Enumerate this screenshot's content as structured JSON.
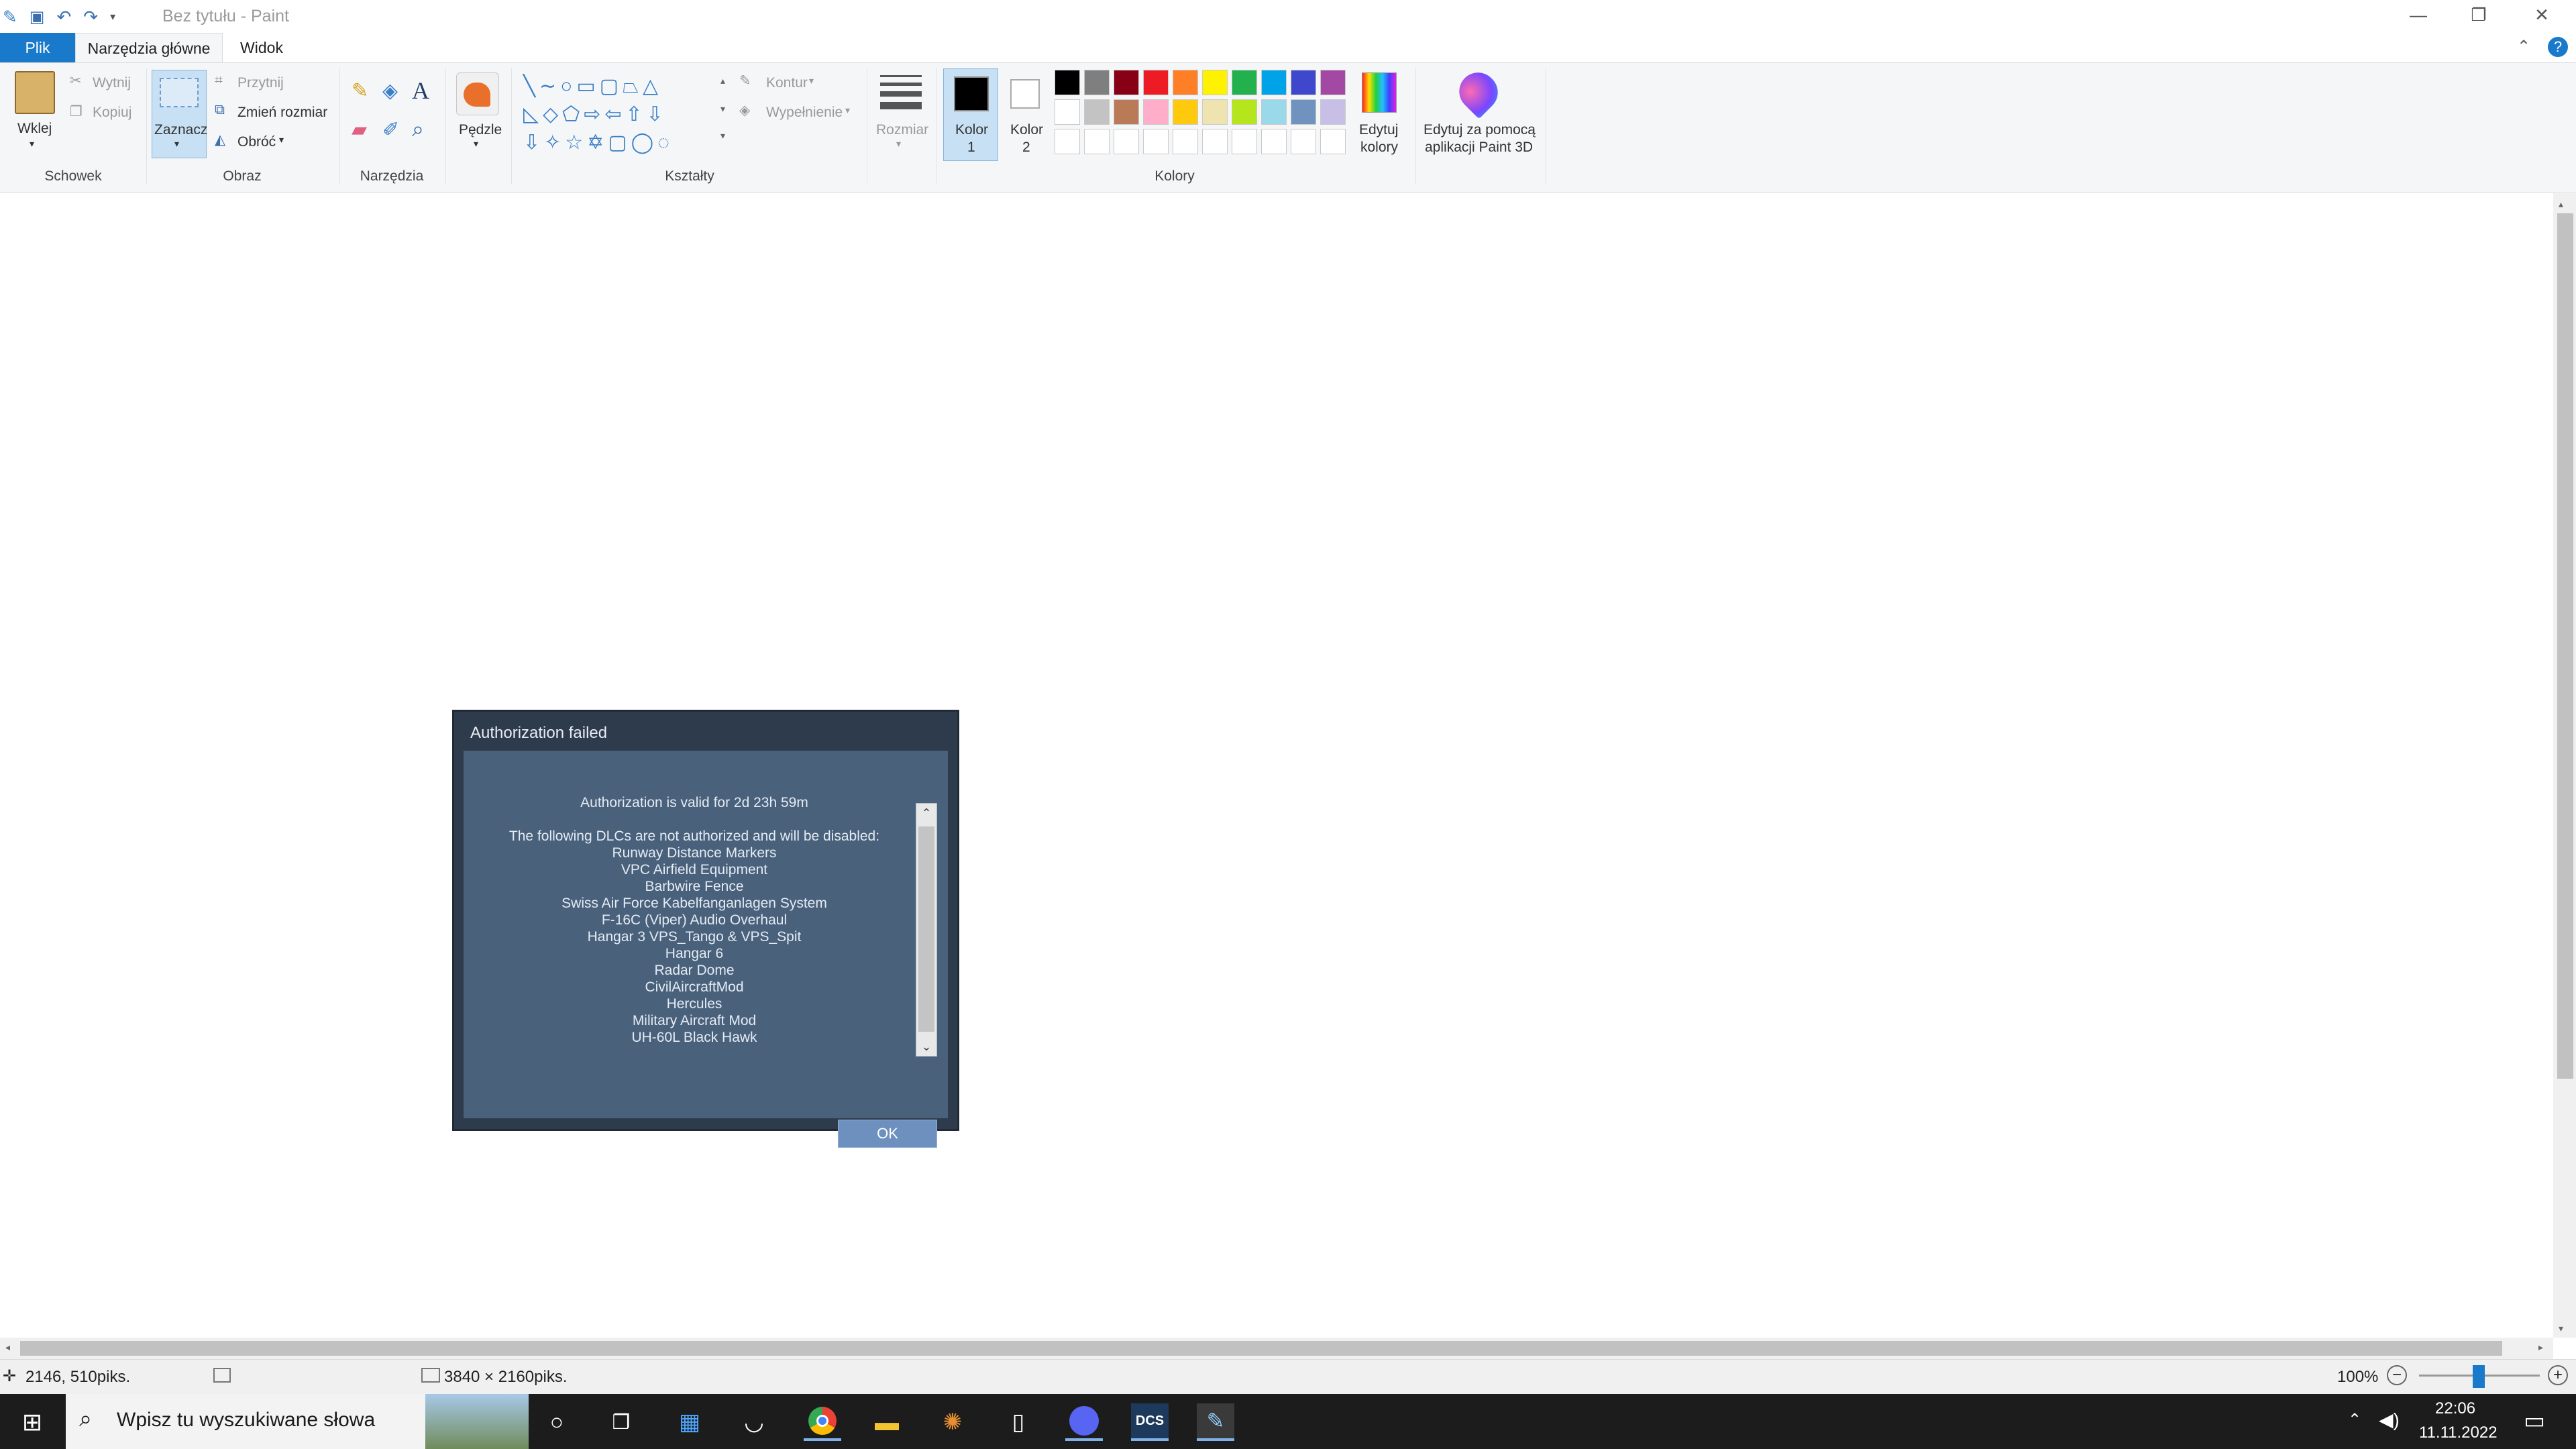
{
  "window": {
    "title": "Bez tytułu - Paint",
    "controls": {
      "minimize": "—",
      "restore": "❐",
      "close": "✕"
    }
  },
  "ribbon_tabs": [
    {
      "label": "Plik",
      "active": false
    },
    {
      "label": "Narzędzia główne",
      "active": true
    },
    {
      "label": "Widok",
      "active": false
    }
  ],
  "ribbon": {
    "clipboard": {
      "paste": "Wklej",
      "cut": "Wytnij",
      "copy": "Kopiuj",
      "group": "Schowek"
    },
    "image": {
      "select": "Zaznacz",
      "crop": "Przytnij",
      "resize": "Zmień rozmiar",
      "rotate": "Obróć",
      "group": "Obraz"
    },
    "tools": {
      "group": "Narzędzia"
    },
    "brushes": {
      "label": "Pędzle"
    },
    "shapes": {
      "outline": "Kontur",
      "fill": "Wypełnienie",
      "group": "Kształty"
    },
    "size": {
      "label": "Rozmiar"
    },
    "colors": {
      "color1_label": "Kolor",
      "color1_num": "1",
      "color2_label": "Kolor",
      "color2_num": "2",
      "edit_label1": "Edytuj",
      "edit_label2": "kolory",
      "group": "Kolory",
      "color1": "#000000",
      "color2": "#ffffff",
      "palette_row1": [
        "#000000",
        "#7f7f7f",
        "#880015",
        "#ed1c24",
        "#ff7f27",
        "#fff200",
        "#22b14c",
        "#00a2e8",
        "#3f48cc",
        "#a349a4"
      ],
      "palette_row2": [
        "#ffffff",
        "#c3c3c3",
        "#b97a57",
        "#ffaec9",
        "#ffc90e",
        "#efe4b0",
        "#b5e61d",
        "#99d9ea",
        "#7092be",
        "#c8bfe7"
      ]
    },
    "paint3d": {
      "line1": "Edytuj za pomocą",
      "line2": "aplikacji Paint 3D"
    }
  },
  "dialog": {
    "title": "Authorization failed",
    "valid_line": "Authorization is valid for 2d 23h 59m",
    "intro": "The following DLCs are not authorized and will be disabled:",
    "items": [
      "Runway Distance Markers",
      "VPC Airfield Equipment",
      "Barbwire Fence",
      "Swiss Air Force Kabelfanganlagen System",
      "F-16C (Viper) Audio Overhaul",
      "Hangar 3 VPS_Tango & VPS_Spit",
      "Hangar 6",
      "Radar Dome",
      "CivilAircraftMod",
      "Hercules",
      "Military Aircraft Mod",
      "UH-60L Black Hawk"
    ],
    "ok": "OK"
  },
  "statusbar": {
    "cursor": "2146, 510piks.",
    "dimensions": "3840 × 2160piks.",
    "zoom": "100%"
  },
  "taskbar": {
    "search_placeholder": "Wpisz tu wyszukiwane słowa",
    "dcs_label": "DCS",
    "time": "22:06",
    "date": "11.11.2022"
  }
}
